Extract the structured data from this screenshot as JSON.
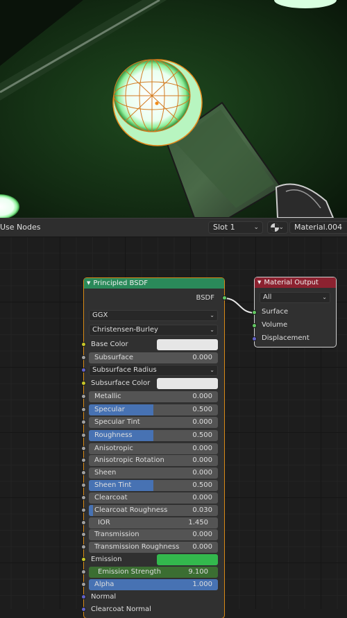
{
  "header": {
    "use_nodes_label": "Use Nodes",
    "slot_label": "Slot 1",
    "material_name": "Material.004",
    "shading_icon": "sphere-material-icon"
  },
  "principled": {
    "title": "Principled BSDF",
    "output_label": "BSDF",
    "distribution": "GGX",
    "subsurface_method": "Christensen-Burley",
    "base_color_label": "Base Color",
    "subsurface_label": "Subsurface",
    "subsurface_value": "0.000",
    "subsurface_radius_label": "Subsurface Radius",
    "subsurface_color_label": "Subsurface Color",
    "metallic_label": "Metallic",
    "metallic_value": "0.000",
    "specular_label": "Specular",
    "specular_value": "0.500",
    "specular_tint_label": "Specular Tint",
    "specular_tint_value": "0.000",
    "roughness_label": "Roughness",
    "roughness_value": "0.500",
    "anisotropic_label": "Anisotropic",
    "anisotropic_value": "0.000",
    "anisotropic_rotation_label": "Anisotropic Rotation",
    "anisotropic_rotation_value": "0.000",
    "sheen_label": "Sheen",
    "sheen_value": "0.000",
    "sheen_tint_label": "Sheen Tint",
    "sheen_tint_value": "0.500",
    "clearcoat_label": "Clearcoat",
    "clearcoat_value": "0.000",
    "clearcoat_roughness_label": "Clearcoat Roughness",
    "clearcoat_roughness_value": "0.030",
    "ior_label": "IOR",
    "ior_value": "1.450",
    "transmission_label": "Transmission",
    "transmission_value": "0.000",
    "transmission_roughness_label": "Transmission Roughness",
    "transmission_roughness_value": "0.000",
    "emission_label": "Emission",
    "emission_strength_label": "Emission Strength",
    "emission_strength_value": "9.100",
    "alpha_label": "Alpha",
    "alpha_value": "1.000",
    "normal_label": "Normal",
    "clearcoat_normal_label": "Clearcoat Normal"
  },
  "material_output": {
    "title": "Material Output",
    "target": "All",
    "surface_label": "Surface",
    "volume_label": "Volume",
    "displacement_label": "Displacement"
  },
  "colors": {
    "base_color": "#e6e6e6",
    "subsurface_color": "#e6e6e6",
    "emission_color": "#33b84d",
    "principled_header": "#2a8a5a",
    "output_header": "#8c2230",
    "slider_fill": "#4772b3",
    "selected_outline": "#d98a16"
  }
}
